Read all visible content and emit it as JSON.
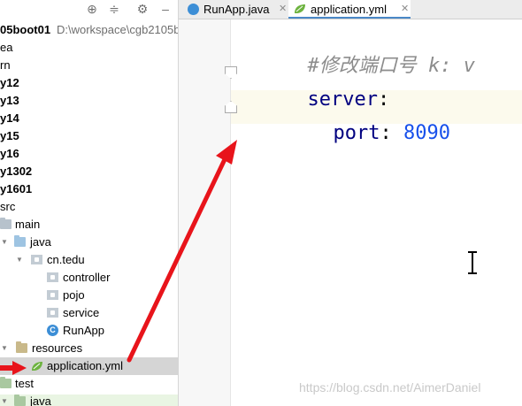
{
  "project_panel": {
    "root_name": "05boot01",
    "root_path": "D:\\workspace\\cgb2105b",
    "items": [
      {
        "label": "ea"
      },
      {
        "label": "rn"
      },
      {
        "label": "y12"
      },
      {
        "label": "y13"
      },
      {
        "label": "y14"
      },
      {
        "label": "y15"
      },
      {
        "label": "y16"
      },
      {
        "label": "y1302"
      },
      {
        "label": "y1601"
      },
      {
        "label": "src"
      },
      {
        "label": "main"
      },
      {
        "label": "java"
      },
      {
        "label": "cn.tedu"
      },
      {
        "label": "controller"
      },
      {
        "label": "pojo"
      },
      {
        "label": "service"
      },
      {
        "label": "RunApp"
      },
      {
        "label": "resources"
      },
      {
        "label": "application.yml"
      },
      {
        "label": "test"
      },
      {
        "label": "java"
      }
    ]
  },
  "tabs": [
    {
      "label": "RunApp.java"
    },
    {
      "label": "application.yml"
    }
  ],
  "editor": {
    "lines": [
      {
        "text": "#修改端口号 k: v"
      },
      {
        "key": "server",
        "sep": ":"
      },
      {
        "key": "port",
        "sep": ": ",
        "value": "8090"
      }
    ]
  },
  "watermark": "https://blog.csdn.net/AimerDaniel",
  "colors": {
    "annotation_arrow": "#e8141b",
    "comment": "#8c8c8c",
    "yaml_key": "#000080",
    "number": "#1750eb",
    "selected_row": "#d5d5d5"
  },
  "icons": [
    "target-icon",
    "collapse-icon",
    "gear-icon",
    "minimize-icon",
    "class-icon",
    "yaml-leaf-icon",
    "folder-icon",
    "package-icon"
  ]
}
